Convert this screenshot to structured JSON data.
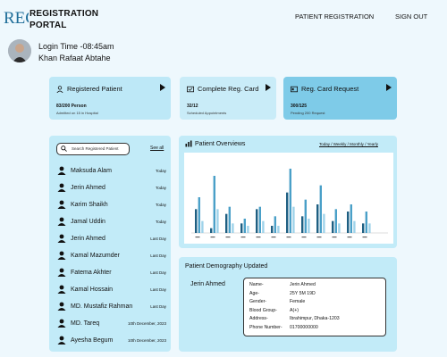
{
  "header": {
    "brand_line1": "REGISTRATION",
    "brand_line2": "PORTAL",
    "logo_text": "REG",
    "nav_registration": "PATIENT REGISTRATION",
    "nav_signout": "SIGN OUT"
  },
  "user": {
    "login_time": "Login Time -08:45am",
    "name": "Khan Rafaat Abtahe"
  },
  "cards": [
    {
      "title": "Registered Patient",
      "value": "83/200 Person",
      "sub": "Admitted on 15 in Hospital",
      "icon": "person-icon"
    },
    {
      "title": "Complete Reg. Card",
      "value": "32/12",
      "sub": "Scheduled Appointments",
      "icon": "card-check-icon"
    },
    {
      "title": "Reg. Card Request",
      "value": "300/125",
      "sub": "Pending 200 Request",
      "icon": "id-card-icon"
    }
  ],
  "patients": {
    "search_placeholder": "Search Registered Patient",
    "see_all": "See all",
    "items": [
      {
        "name": "Maksuda Alam",
        "date": "Today"
      },
      {
        "name": "Jerin Ahmed",
        "date": "Today"
      },
      {
        "name": "Karim Shaikh",
        "date": "Today"
      },
      {
        "name": "Jamal Uddin",
        "date": "Today"
      },
      {
        "name": "Jerin Ahmed",
        "date": "Last Day"
      },
      {
        "name": "Kamal Mazumder",
        "date": "Last Day"
      },
      {
        "name": "Fatema Akhter",
        "date": "Last Day"
      },
      {
        "name": "Kamal Hossain",
        "date": "Last Day"
      },
      {
        "name": "MD. Mustafiz Rahman",
        "date": "Last Day"
      },
      {
        "name": "MD. Tareq",
        "date": "10th December, 2023"
      },
      {
        "name": "Ayesha Begum",
        "date": "10th December, 2023"
      }
    ]
  },
  "overview": {
    "title": "Patient Overviews",
    "filters": "Today / Weekly / Monthly / Yearly"
  },
  "chart_data": {
    "type": "bar",
    "categories": [
      "1",
      "2",
      "3",
      "4",
      "5",
      "6",
      "7",
      "8",
      "9",
      "10",
      "11",
      "12"
    ],
    "series": [
      {
        "values": [
          10,
          2,
          8,
          4,
          10,
          3,
          17,
          7,
          12,
          5,
          9,
          4
        ]
      },
      {
        "values": [
          15,
          24,
          11,
          6,
          11,
          7,
          27,
          14,
          20,
          10,
          12,
          9
        ]
      },
      {
        "values": [
          5,
          10,
          4,
          3,
          5,
          3,
          11,
          6,
          8,
          4,
          5,
          4
        ]
      }
    ],
    "colors": [
      "#1e5f82",
      "#4aa0c8",
      "#9fd3ea"
    ]
  },
  "demography": {
    "title": "Patient Demography Updated",
    "patient": "Jerin Ahmed",
    "fields": [
      {
        "label": "Name-",
        "value": "Jerin Ahmed"
      },
      {
        "label": "Age-",
        "value": "25Y 5M 19D"
      },
      {
        "label": "Gender-",
        "value": "Female"
      },
      {
        "label": "Blood Group-",
        "value": "A(+)"
      },
      {
        "label": "Address-",
        "value": "Ibrahimpur, Dhaka-1203"
      },
      {
        "label": "Phone Number-",
        "value": "01700000000"
      }
    ]
  }
}
